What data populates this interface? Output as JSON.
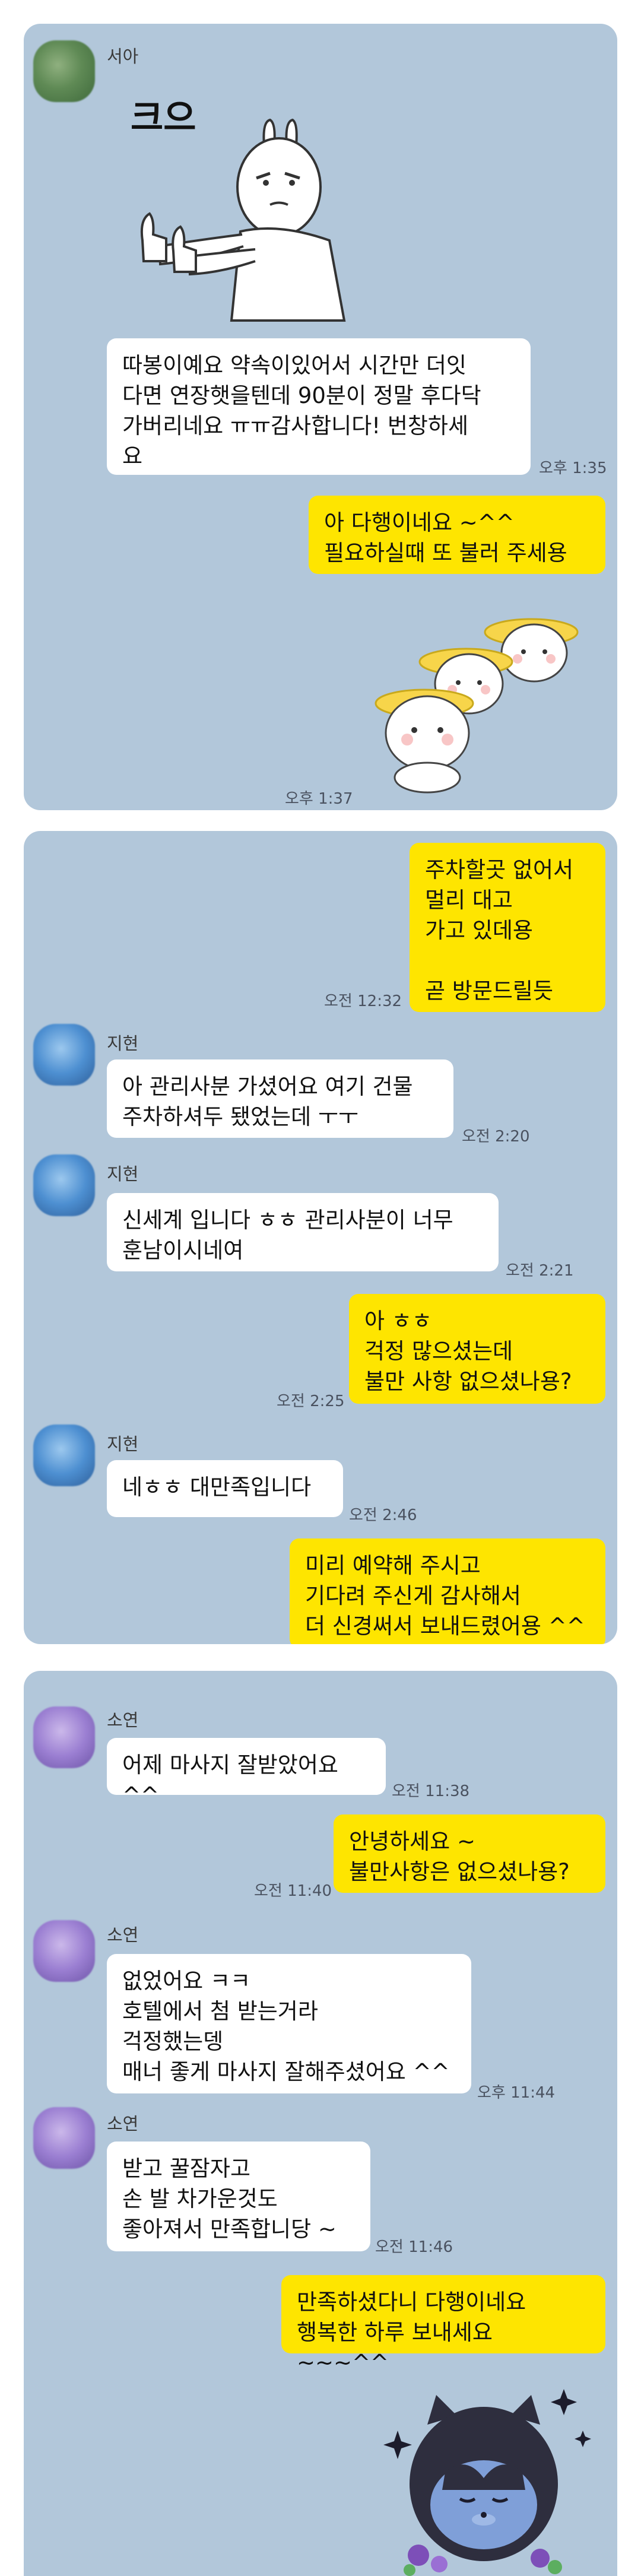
{
  "panel1": {
    "name": "서아",
    "sticker_text": "크으",
    "msg1": "따봉이예요 약속이있어서 시간만 더잇\n다면 연장햇을텐데 90분이 정말 후다닥\n가버리네요 ㅠㅠ감사합니다! 번창하세\n요",
    "time1": "오후 1:35",
    "msg2": "아 다행이네요 ~^^\n필요하실때 또 불러 주세용",
    "time2": "오후 1:37"
  },
  "panel2": {
    "out1": "주차할곳 없어서\n멀리 대고\n가고 있데용\n\n곧 방문드릴듯",
    "out1_time": "오전 12:32",
    "name": "지현",
    "in1": "아 관리사분 가셨어요 여기 건물\n주차하셔두 됐었는데 ㅜㅜ",
    "in1_time": "오전 2:20",
    "in2": "신세계 입니다 ㅎㅎ 관리사분이 너무\n훈남이시네여",
    "in2_time": "오전 2:21",
    "out2": "아 ㅎㅎ\n걱정 많으셨는데\n불만 사항 없으셨나용?",
    "out2_time": "오전 2:25",
    "in3": "네ㅎㅎ 대만족입니다",
    "in3_time": "오전 2:46",
    "out3": "미리 예약해 주시고\n기다려 주신게 감사해서\n더 신경써서 보내드렸어용 ^^"
  },
  "panel3": {
    "name": "소연",
    "in1": "어제 마사지 잘받았어요 ^^",
    "in1_time": "오전 11:38",
    "out1": "안녕하세요 ~\n불만사항은 없으셨나용?",
    "out1_time": "오전 11:40",
    "in2": "없었어요 ㅋㅋ\n호텔에서 첨 받는거라\n걱정했는뎅\n매너 좋게 마사지 잘해주셨어요 ^^",
    "in2_time": "오후 11:44",
    "in3": "받고 꿀잠자고\n손 발 차가운것도\n좋아져서 만족합니당 ~",
    "in3_time": "오전 11:46",
    "out2": "만족하셨다니 다행이네요\n행복한 하루 보내세요 ~~~^^"
  },
  "colors": {
    "chat_bg": "#b2c7da",
    "outgoing_bubble": "#fee500",
    "incoming_bubble": "#ffffff"
  }
}
